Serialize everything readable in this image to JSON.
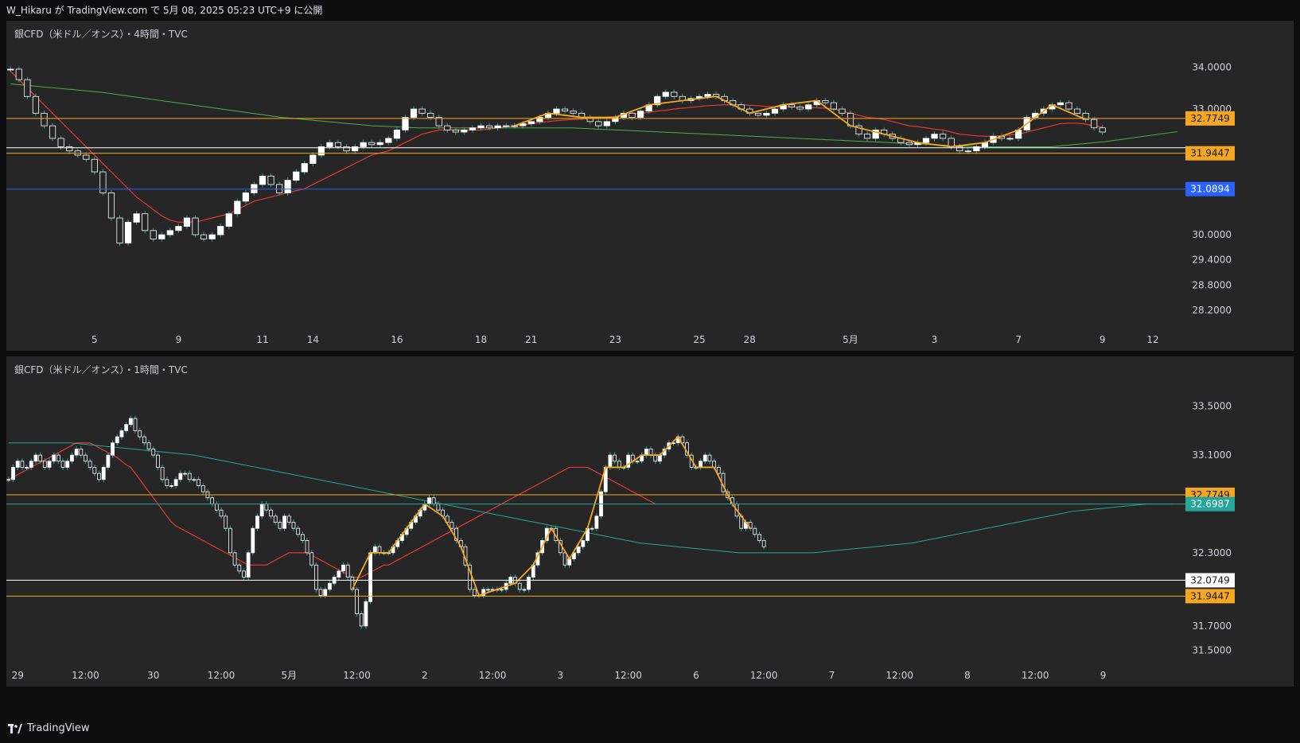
{
  "header": {
    "publish_line": "W_Hikaru が TradingView.com で 5月 08, 2025 05:23 UTC+9 に公開"
  },
  "footer": {
    "brand": "TradingView"
  },
  "colors": {
    "up": "#ffffff",
    "down": "#ffffff",
    "wick": "#26a69a",
    "ma_fast": "#e53935",
    "ma_slow_4h": "#4caf50",
    "ma_slow_1h": "#26a69a",
    "zigzag": "#f5a623",
    "orange_line": "#f5a623",
    "white_line": "#ffffff",
    "blue_line": "#2962ff"
  },
  "chart_data": [
    {
      "type": "candlestick",
      "title": "銀CFD（米ドル／オンス）・4時間・TVC",
      "ylim": [
        27.8,
        34.5
      ],
      "y_ticks": [
        "34.0000",
        "33.0000",
        "30.0000",
        "29.4000",
        "28.8000",
        "28.2000"
      ],
      "y_tick_values": [
        34.0,
        33.0,
        30.0,
        29.4,
        28.8,
        28.2
      ],
      "x_ticks": [
        "5",
        "9",
        "11",
        "14",
        "16",
        "18",
        "21",
        "23",
        "25",
        "28",
        "5月",
        "3",
        "7",
        "9",
        "12"
      ],
      "x_tick_index": [
        10,
        20,
        30,
        36,
        46,
        56,
        62,
        72,
        82,
        88,
        100,
        110,
        120,
        130,
        136
      ],
      "n_slots": 140,
      "price_levels": [
        {
          "value": 32.7749,
          "label": "32.7749",
          "kind": "orange"
        },
        {
          "value": 31.9447,
          "label": "31.9447",
          "kind": "orange"
        },
        {
          "value": 32.075,
          "label": "",
          "kind": "white"
        },
        {
          "value": 31.0894,
          "label": "31.0894",
          "kind": "blue"
        }
      ],
      "closes": [
        33.95,
        33.7,
        33.3,
        32.9,
        32.6,
        32.3,
        32.1,
        32.0,
        31.9,
        31.8,
        31.5,
        31.0,
        30.4,
        29.8,
        30.3,
        30.5,
        30.1,
        29.9,
        30.0,
        30.1,
        30.2,
        30.4,
        30.0,
        29.9,
        30.0,
        30.2,
        30.5,
        30.8,
        31.0,
        31.2,
        31.4,
        31.2,
        31.0,
        31.3,
        31.5,
        31.7,
        31.9,
        32.1,
        32.2,
        32.1,
        32.0,
        32.1,
        32.2,
        32.15,
        32.2,
        32.3,
        32.5,
        32.8,
        33.0,
        32.9,
        32.8,
        32.6,
        32.5,
        32.45,
        32.5,
        32.55,
        32.6,
        32.55,
        32.6,
        32.6,
        32.6,
        32.65,
        32.7,
        32.8,
        32.9,
        33.0,
        32.95,
        32.9,
        32.8,
        32.7,
        32.6,
        32.7,
        32.8,
        32.9,
        32.8,
        32.95,
        33.1,
        33.3,
        33.4,
        33.3,
        33.2,
        33.25,
        33.3,
        33.35,
        33.3,
        33.2,
        33.1,
        33.0,
        32.9,
        32.85,
        32.9,
        33.0,
        33.1,
        33.05,
        33.0,
        33.1,
        33.2,
        33.15,
        33.0,
        32.9,
        32.6,
        32.4,
        32.3,
        32.5,
        32.4,
        32.3,
        32.2,
        32.15,
        32.2,
        32.3,
        32.4,
        32.3,
        32.1,
        32.0,
        32.0,
        32.1,
        32.2,
        32.35,
        32.3,
        32.3,
        32.5,
        32.8,
        32.9,
        33.0,
        33.1,
        33.15,
        33.0,
        32.9,
        32.75,
        32.55,
        32.45
      ],
      "ma_fast": [
        33.9,
        33.7,
        33.5,
        33.3,
        33.1,
        32.9,
        32.7,
        32.5,
        32.3,
        32.1,
        31.9,
        31.7,
        31.5,
        31.3,
        31.1,
        30.9,
        30.75,
        30.6,
        30.45,
        30.35,
        30.3,
        30.3,
        30.3,
        30.35,
        30.4,
        30.45,
        30.5,
        30.6,
        30.7,
        30.8,
        30.85,
        30.9,
        30.95,
        31.0,
        31.05,
        31.1,
        31.2,
        31.3,
        31.4,
        31.5,
        31.6,
        31.7,
        31.8,
        31.9,
        31.95,
        32.0,
        32.1,
        32.2,
        32.3,
        32.4,
        32.45,
        32.5,
        32.5,
        32.5,
        32.5,
        32.5,
        32.5,
        32.52,
        32.55,
        32.58,
        32.6,
        32.62,
        32.65,
        32.68,
        32.7,
        32.72,
        32.74,
        32.75,
        32.76,
        32.77,
        32.78,
        32.8,
        32.82,
        32.85,
        32.88,
        32.9,
        32.92,
        32.95,
        32.97,
        33.0,
        33.02,
        33.04,
        33.06,
        33.08,
        33.09,
        33.1,
        33.1,
        33.1,
        33.09,
        33.08,
        33.06,
        33.05,
        33.05,
        33.05,
        33.04,
        33.03,
        33.03,
        33.02,
        33.0,
        32.95,
        32.9,
        32.85,
        32.8,
        32.78,
        32.75,
        32.7,
        32.65,
        32.6,
        32.58,
        32.55,
        32.52,
        32.5,
        32.45,
        32.4,
        32.38,
        32.36,
        32.35,
        32.35,
        32.36,
        32.38,
        32.4,
        32.45,
        32.5,
        32.55,
        32.6,
        32.65,
        32.66,
        32.66,
        32.64,
        32.6,
        32.57
      ],
      "ma_slow": [
        33.6,
        33.58,
        33.56,
        33.54,
        33.52,
        33.5,
        33.48,
        33.46,
        33.44,
        33.42,
        33.4,
        33.37,
        33.34,
        33.31,
        33.28,
        33.25,
        33.22,
        33.19,
        33.16,
        33.13,
        33.1,
        33.07,
        33.04,
        33.01,
        32.98,
        32.95,
        32.92,
        32.89,
        32.86,
        32.83,
        32.8,
        32.78,
        32.76,
        32.74,
        32.72,
        32.7,
        32.68,
        32.66,
        32.64,
        32.62,
        32.6,
        32.59,
        32.58,
        32.57,
        32.56,
        32.55,
        32.55,
        32.55,
        32.55,
        32.55,
        32.55,
        32.55,
        32.55,
        32.55,
        32.55,
        32.55,
        32.55,
        32.55,
        32.55,
        32.55,
        32.55,
        32.55,
        32.55,
        32.54,
        32.53,
        32.52,
        32.51,
        32.5,
        32.49,
        32.48,
        32.47,
        32.46,
        32.45,
        32.44,
        32.43,
        32.42,
        32.41,
        32.4,
        32.39,
        32.38,
        32.37,
        32.36,
        32.35,
        32.34,
        32.33,
        32.32,
        32.31,
        32.3,
        32.29,
        32.28,
        32.27,
        32.26,
        32.25,
        32.24,
        32.23,
        32.22,
        32.21,
        32.2,
        32.19,
        32.18,
        32.17,
        32.16,
        32.15,
        32.14,
        32.13,
        32.12,
        32.11,
        32.1,
        32.1,
        32.1,
        32.1,
        32.1,
        32.1,
        32.1,
        32.1,
        32.1,
        32.12,
        32.14,
        32.16,
        32.18,
        32.2,
        32.22,
        32.25,
        32.28,
        32.31,
        32.34,
        32.37,
        32.4,
        32.43,
        32.46
      ]
    },
    {
      "type": "candlestick",
      "title": "銀CFD（米ドル／オンス）・1時間・TVC",
      "ylim": [
        31.4,
        33.7
      ],
      "y_ticks": [
        "33.5000",
        "33.1000",
        "32.3000",
        "31.7000",
        "31.5000"
      ],
      "y_tick_values": [
        33.5,
        33.1,
        32.3,
        31.7,
        31.5
      ],
      "x_ticks": [
        "29",
        "12:00",
        "30",
        "12:00",
        "5月",
        "12:00",
        "2",
        "12:00",
        "3",
        "12:00",
        "6",
        "12:00",
        "7",
        "12:00",
        "8",
        "12:00",
        "9"
      ],
      "x_tick_index": [
        2,
        17,
        32,
        47,
        62,
        77,
        92,
        107,
        122,
        137,
        152,
        167,
        182,
        197,
        212,
        227,
        242
      ],
      "n_slots": 260,
      "price_levels": [
        {
          "value": 32.7749,
          "label": "32.7749",
          "kind": "orange"
        },
        {
          "value": 32.6987,
          "label": "32.6987",
          "kind": "teal"
        },
        {
          "value": 32.0749,
          "label": "32.0749",
          "kind": "white"
        },
        {
          "value": 31.9447,
          "label": "31.9447",
          "kind": "orange"
        }
      ],
      "closes": [
        32.9,
        33.0,
        33.05,
        33.0,
        33.0,
        33.05,
        33.1,
        33.05,
        33.0,
        33.05,
        33.1,
        33.05,
        33.0,
        33.05,
        33.1,
        33.15,
        33.1,
        33.05,
        33.0,
        32.95,
        32.9,
        33.0,
        33.1,
        33.2,
        33.25,
        33.3,
        33.35,
        33.4,
        33.3,
        33.25,
        33.2,
        33.15,
        33.1,
        33.0,
        32.9,
        32.85,
        32.85,
        32.9,
        32.95,
        32.95,
        32.9,
        32.9,
        32.85,
        32.8,
        32.75,
        32.7,
        32.65,
        32.6,
        32.5,
        32.3,
        32.2,
        32.15,
        32.1,
        32.3,
        32.5,
        32.6,
        32.7,
        32.65,
        32.6,
        32.55,
        32.5,
        32.6,
        32.55,
        32.5,
        32.45,
        32.4,
        32.3,
        32.2,
        32.0,
        31.95,
        32.0,
        32.05,
        32.1,
        32.15,
        32.2,
        32.1,
        32.0,
        31.8,
        31.7,
        31.9,
        32.3,
        32.35,
        32.3,
        32.3,
        32.3,
        32.35,
        32.4,
        32.45,
        32.5,
        32.55,
        32.6,
        32.65,
        32.7,
        32.75,
        32.7,
        32.65,
        32.6,
        32.55,
        32.5,
        32.4,
        32.35,
        32.2,
        32.0,
        31.95,
        31.95,
        32.0,
        32.0,
        32.0,
        32.0,
        32.0,
        32.05,
        32.1,
        32.05,
        32.0,
        32.0,
        32.1,
        32.2,
        32.3,
        32.4,
        32.5,
        32.5,
        32.4,
        32.3,
        32.2,
        32.25,
        32.3,
        32.35,
        32.4,
        32.5,
        32.5,
        32.6,
        32.8,
        33.0,
        33.1,
        33.05,
        33.0,
        33.0,
        33.1,
        33.05,
        33.05,
        33.1,
        33.15,
        33.1,
        33.05,
        33.1,
        33.15,
        33.2,
        33.2,
        33.25,
        33.2,
        33.1,
        33.0,
        33.0,
        33.05,
        33.1,
        33.05,
        33.0,
        32.95,
        32.8,
        32.75,
        32.7,
        32.6,
        32.5,
        32.55,
        32.5,
        32.45,
        32.4,
        32.35
      ],
      "ma_fast": [
        32.9,
        32.92,
        32.94,
        32.96,
        32.98,
        33.0,
        33.02,
        33.04,
        33.06,
        33.08,
        33.1,
        33.12,
        33.14,
        33.16,
        33.18,
        33.2,
        33.2,
        33.2,
        33.2,
        33.18,
        33.16,
        33.14,
        33.12,
        33.1,
        33.08,
        33.05,
        33.02,
        33.0,
        32.95,
        32.9,
        32.85,
        32.8,
        32.75,
        32.7,
        32.65,
        32.6,
        32.55,
        32.52,
        32.5,
        32.48,
        32.46,
        32.44,
        32.42,
        32.4,
        32.38,
        32.36,
        32.34,
        32.32,
        32.3,
        32.28,
        32.26,
        32.24,
        32.22,
        32.2,
        32.2,
        32.2,
        32.2,
        32.2,
        32.22,
        32.24,
        32.26,
        32.28,
        32.3,
        32.3,
        32.3,
        32.3,
        32.3,
        32.28,
        32.26,
        32.24,
        32.22,
        32.2,
        32.18,
        32.16,
        32.14,
        32.12,
        32.1,
        32.1,
        32.1,
        32.12,
        32.14,
        32.16,
        32.18,
        32.2,
        32.2,
        32.22,
        32.24,
        32.26,
        32.28,
        32.3,
        32.32,
        32.34,
        32.36,
        32.38,
        32.4,
        32.42,
        32.44,
        32.46,
        32.48,
        32.5,
        32.52,
        32.54,
        32.56,
        32.58,
        32.6,
        32.62,
        32.64,
        32.66,
        32.68,
        32.7,
        32.72,
        32.74,
        32.76,
        32.78,
        32.8,
        32.82,
        32.84,
        32.86,
        32.88,
        32.9,
        32.92,
        32.94,
        32.96,
        32.98,
        33.0,
        33.0,
        33.0,
        33.0,
        33.0,
        32.98,
        32.96,
        32.94,
        32.92,
        32.9,
        32.88,
        32.86,
        32.84,
        32.82,
        32.8,
        32.78,
        32.76,
        32.74,
        32.72,
        32.7
      ],
      "ma_slow": [
        33.2,
        33.2,
        33.2,
        33.2,
        33.2,
        33.2,
        33.19,
        33.18,
        33.17,
        33.16,
        33.15,
        33.14,
        33.13,
        33.12,
        33.11,
        33.1,
        33.08,
        33.06,
        33.04,
        33.02,
        33.0,
        32.98,
        32.96,
        32.94,
        32.92,
        32.9,
        32.88,
        32.86,
        32.84,
        32.82,
        32.8,
        32.78,
        32.76,
        32.74,
        32.72,
        32.7,
        32.68,
        32.66,
        32.64,
        32.62,
        32.6,
        32.58,
        32.56,
        32.54,
        32.52,
        32.5,
        32.48,
        32.46,
        32.44,
        32.42,
        32.4,
        32.38,
        32.37,
        32.36,
        32.35,
        32.34,
        32.33,
        32.32,
        32.31,
        32.3,
        32.3,
        32.3,
        32.3,
        32.3,
        32.3,
        32.3,
        32.31,
        32.32,
        32.33,
        32.34,
        32.35,
        32.36,
        32.37,
        32.38,
        32.4,
        32.42,
        32.44,
        32.46,
        32.48,
        32.5,
        32.52,
        32.54,
        32.56,
        32.58,
        32.6,
        32.62,
        32.64,
        32.65,
        32.66,
        32.67,
        32.68,
        32.69,
        32.7,
        32.7,
        32.7
      ]
    }
  ]
}
